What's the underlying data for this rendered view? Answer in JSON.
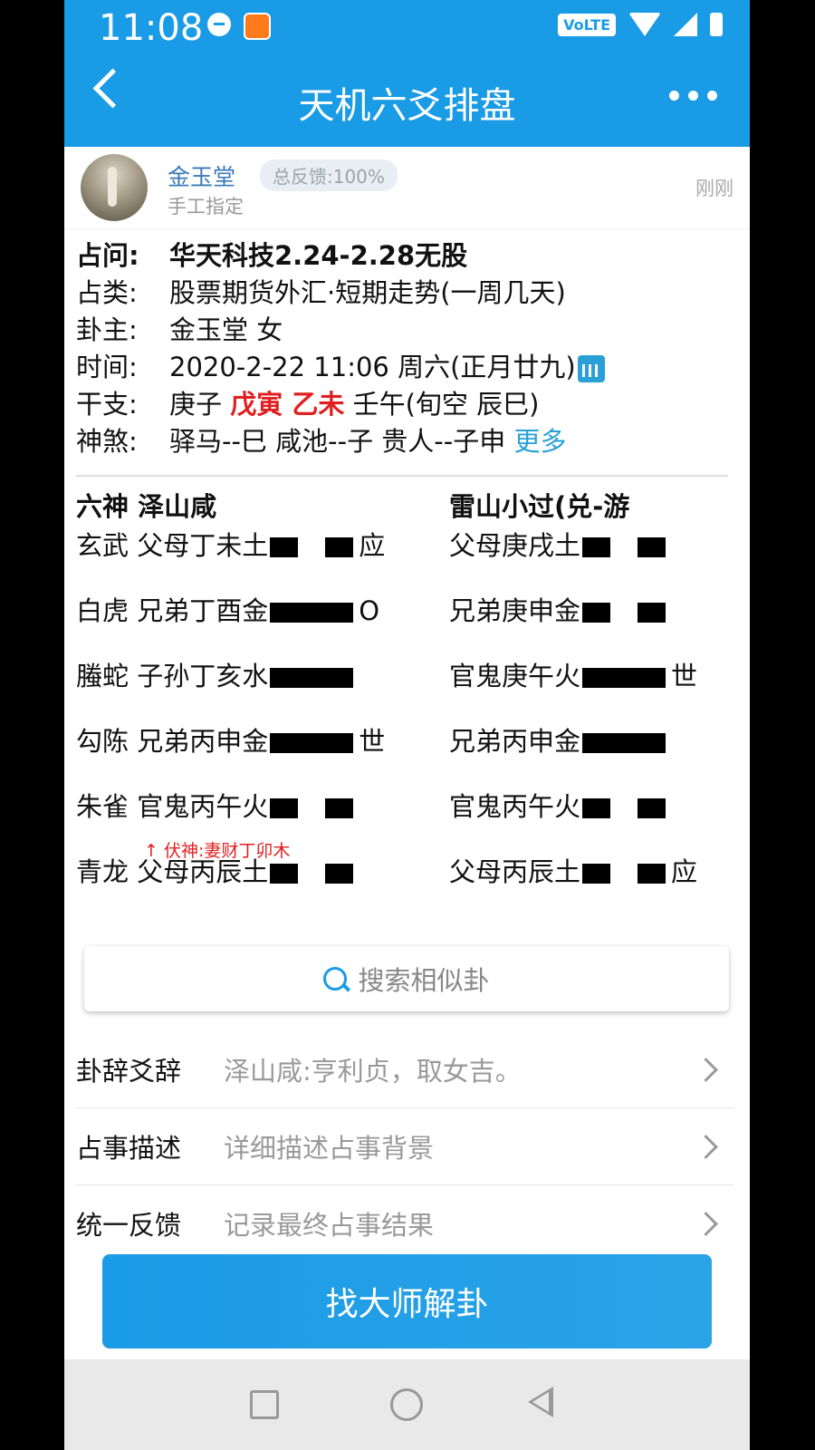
{
  "status_bar": {
    "time": "11:08",
    "network": "VoLTE"
  },
  "app_bar": {
    "title": "天机六爻排盘"
  },
  "user": {
    "name": "金玉堂",
    "feedback": "总反馈:100%",
    "sub": "手工指定",
    "time": "刚刚"
  },
  "info": {
    "question": {
      "label": "占问:",
      "value": "华天科技2.24-2.28无股"
    },
    "category": {
      "label": "占类:",
      "value": "股票期货外汇·短期走势(一周几天)"
    },
    "owner": {
      "label": "卦主:",
      "value": "金玉堂 女"
    },
    "time": {
      "label": "时间:",
      "value": "2020-2-22 11:06 周六(正月廿九)"
    },
    "ganzhi": {
      "label": "干支:",
      "p1": "庚子",
      "p2": "戊寅 乙未",
      "p3": "壬午(旬空 辰巳)"
    },
    "shensha": {
      "label": "神煞:",
      "value": "驿马--巳 咸池--子 贵人--子申",
      "more": "更多"
    }
  },
  "hexagram": {
    "left_title": "六神 泽山咸",
    "right_title": "雷山小过(兑-游",
    "left_lines": [
      {
        "text": "玄武 父母丁未土",
        "type": "yin",
        "mark": "应"
      },
      {
        "text": "白虎 兄弟丁酉金",
        "type": "yang",
        "mark": "O"
      },
      {
        "text": "螣蛇 子孙丁亥水",
        "type": "yang",
        "mark": ""
      },
      {
        "text": "勾陈 兄弟丙申金",
        "type": "yang",
        "mark": "世"
      },
      {
        "text": "朱雀 官鬼丙午火",
        "type": "yin",
        "mark": ""
      },
      {
        "text": "青龙 父母丙辰土",
        "type": "yin",
        "mark": ""
      }
    ],
    "right_lines": [
      {
        "text": "父母庚戌土",
        "type": "yin",
        "mark": ""
      },
      {
        "text": "兄弟庚申金",
        "type": "yin",
        "mark": ""
      },
      {
        "text": "官鬼庚午火",
        "type": "yang",
        "mark": "世"
      },
      {
        "text": "兄弟丙申金",
        "type": "yang",
        "mark": ""
      },
      {
        "text": "官鬼丙午火",
        "type": "yin",
        "mark": ""
      },
      {
        "text": "父母丙辰土",
        "type": "yin",
        "mark": "应"
      }
    ],
    "fushen": "↑ 伏神:妻财丁卯木"
  },
  "search_label": "搜索相似卦",
  "rows": [
    {
      "label": "卦辞爻辞",
      "value": "泽山咸:亨利贞，取女吉。"
    },
    {
      "label": "占事描述",
      "value": "详细描述占事背景"
    },
    {
      "label": "统一反馈",
      "value": "记录最终占事结果"
    }
  ],
  "cta_label": "找大师解卦",
  "colors": {
    "primary": "#1a9be5",
    "accent_red": "#e02020",
    "link": "#2aa0d6"
  }
}
